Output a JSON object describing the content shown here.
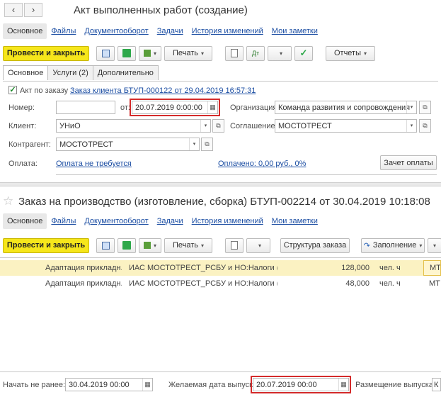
{
  "window1": {
    "title": "Акт выполненных работ (создание)",
    "tabs": [
      "Основное",
      "Файлы",
      "Документооборот",
      "Задачи",
      "История изменений",
      "Мои заметки"
    ],
    "toolbar": {
      "post_close": "Провести и закрыть",
      "print": "Печать",
      "reports": "Отчеты"
    },
    "subtabs": [
      "Основное",
      "Услуги (2)",
      "Дополнительно"
    ],
    "act_by_order": "Акт по заказу",
    "order_link": "Заказ клиента БТУП-000122 от 29.04.2019 16:57:31",
    "number_label": "Номер:",
    "number_value": "",
    "from_label": "от:",
    "date_value": "20.07.2019  0:00:00",
    "org_label": "Организация:",
    "org_value": "Команда развития и сопровождения",
    "client_label": "Клиент:",
    "client_value": "УНиО",
    "agreement_label": "Соглашение:",
    "agreement_value": "МОСТОТРЕСТ",
    "counterparty_label": "Контрагент:",
    "counterparty_value": "МОСТОТРЕСТ",
    "payment_label": "Оплата:",
    "payment_link": "Оплата не требуется",
    "paid_link": "Оплачено: 0,00 руб., 0%",
    "offset_button": "Зачет оплаты"
  },
  "window2": {
    "title": "Заказ на производство (изготовление, сборка) БТУП-002214 от 30.04.2019 10:18:08",
    "tabs": [
      "Основное",
      "Файлы",
      "Документооборот",
      "Задачи",
      "История изменений",
      "Мои заметки"
    ],
    "toolbar": {
      "post_close": "Провести и закрыть",
      "print": "Печать",
      "order_structure": "Структура заказа",
      "fill": "Заполнение"
    },
    "rows": [
      {
        "name": "Адаптация прикладн...",
        "spec": "ИАС МОСТОТРЕСТ_РСБУ и НО:Налоги (расч...",
        "qty": "128,000",
        "unit": "чел. ч",
        "dest": "МТ"
      },
      {
        "name": "Адаптация прикладн...",
        "spec": "ИАС МОСТОТРЕСТ_РСБУ и НО:Налоги (расч...",
        "qty": "48,000",
        "unit": "чел. ч",
        "dest": "МТ"
      }
    ],
    "start_label": "Начать не ранее:",
    "start_value": "30.04.2019 00:00",
    "desired_label": "Желаемая дата выпуска:",
    "desired_value": "20.07.2019 00:00",
    "placement_label": "Размещение выпуска:",
    "placement_value": "К"
  },
  "icons": {
    "back": "‹",
    "forward": "›",
    "star": "☆",
    "calendar": "▦",
    "open": "⧉",
    "dropdown": "▾",
    "check": "✓"
  }
}
